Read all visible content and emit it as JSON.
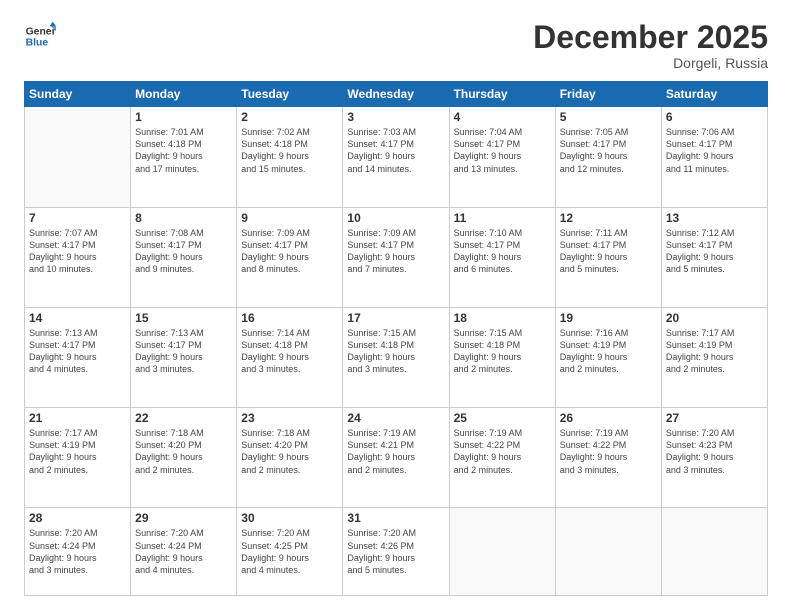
{
  "logo": {
    "line1": "General",
    "line2": "Blue"
  },
  "title": "December 2025",
  "location": "Dorgeli, Russia",
  "days_header": [
    "Sunday",
    "Monday",
    "Tuesday",
    "Wednesday",
    "Thursday",
    "Friday",
    "Saturday"
  ],
  "weeks": [
    [
      {
        "num": "",
        "info": ""
      },
      {
        "num": "1",
        "info": "Sunrise: 7:01 AM\nSunset: 4:18 PM\nDaylight: 9 hours\nand 17 minutes."
      },
      {
        "num": "2",
        "info": "Sunrise: 7:02 AM\nSunset: 4:18 PM\nDaylight: 9 hours\nand 15 minutes."
      },
      {
        "num": "3",
        "info": "Sunrise: 7:03 AM\nSunset: 4:17 PM\nDaylight: 9 hours\nand 14 minutes."
      },
      {
        "num": "4",
        "info": "Sunrise: 7:04 AM\nSunset: 4:17 PM\nDaylight: 9 hours\nand 13 minutes."
      },
      {
        "num": "5",
        "info": "Sunrise: 7:05 AM\nSunset: 4:17 PM\nDaylight: 9 hours\nand 12 minutes."
      },
      {
        "num": "6",
        "info": "Sunrise: 7:06 AM\nSunset: 4:17 PM\nDaylight: 9 hours\nand 11 minutes."
      }
    ],
    [
      {
        "num": "7",
        "info": "Sunrise: 7:07 AM\nSunset: 4:17 PM\nDaylight: 9 hours\nand 10 minutes."
      },
      {
        "num": "8",
        "info": "Sunrise: 7:08 AM\nSunset: 4:17 PM\nDaylight: 9 hours\nand 9 minutes."
      },
      {
        "num": "9",
        "info": "Sunrise: 7:09 AM\nSunset: 4:17 PM\nDaylight: 9 hours\nand 8 minutes."
      },
      {
        "num": "10",
        "info": "Sunrise: 7:09 AM\nSunset: 4:17 PM\nDaylight: 9 hours\nand 7 minutes."
      },
      {
        "num": "11",
        "info": "Sunrise: 7:10 AM\nSunset: 4:17 PM\nDaylight: 9 hours\nand 6 minutes."
      },
      {
        "num": "12",
        "info": "Sunrise: 7:11 AM\nSunset: 4:17 PM\nDaylight: 9 hours\nand 5 minutes."
      },
      {
        "num": "13",
        "info": "Sunrise: 7:12 AM\nSunset: 4:17 PM\nDaylight: 9 hours\nand 5 minutes."
      }
    ],
    [
      {
        "num": "14",
        "info": "Sunrise: 7:13 AM\nSunset: 4:17 PM\nDaylight: 9 hours\nand 4 minutes."
      },
      {
        "num": "15",
        "info": "Sunrise: 7:13 AM\nSunset: 4:17 PM\nDaylight: 9 hours\nand 3 minutes."
      },
      {
        "num": "16",
        "info": "Sunrise: 7:14 AM\nSunset: 4:18 PM\nDaylight: 9 hours\nand 3 minutes."
      },
      {
        "num": "17",
        "info": "Sunrise: 7:15 AM\nSunset: 4:18 PM\nDaylight: 9 hours\nand 3 minutes."
      },
      {
        "num": "18",
        "info": "Sunrise: 7:15 AM\nSunset: 4:18 PM\nDaylight: 9 hours\nand 2 minutes."
      },
      {
        "num": "19",
        "info": "Sunrise: 7:16 AM\nSunset: 4:19 PM\nDaylight: 9 hours\nand 2 minutes."
      },
      {
        "num": "20",
        "info": "Sunrise: 7:17 AM\nSunset: 4:19 PM\nDaylight: 9 hours\nand 2 minutes."
      }
    ],
    [
      {
        "num": "21",
        "info": "Sunrise: 7:17 AM\nSunset: 4:19 PM\nDaylight: 9 hours\nand 2 minutes."
      },
      {
        "num": "22",
        "info": "Sunrise: 7:18 AM\nSunset: 4:20 PM\nDaylight: 9 hours\nand 2 minutes."
      },
      {
        "num": "23",
        "info": "Sunrise: 7:18 AM\nSunset: 4:20 PM\nDaylight: 9 hours\nand 2 minutes."
      },
      {
        "num": "24",
        "info": "Sunrise: 7:19 AM\nSunset: 4:21 PM\nDaylight: 9 hours\nand 2 minutes."
      },
      {
        "num": "25",
        "info": "Sunrise: 7:19 AM\nSunset: 4:22 PM\nDaylight: 9 hours\nand 2 minutes."
      },
      {
        "num": "26",
        "info": "Sunrise: 7:19 AM\nSunset: 4:22 PM\nDaylight: 9 hours\nand 3 minutes."
      },
      {
        "num": "27",
        "info": "Sunrise: 7:20 AM\nSunset: 4:23 PM\nDaylight: 9 hours\nand 3 minutes."
      }
    ],
    [
      {
        "num": "28",
        "info": "Sunrise: 7:20 AM\nSunset: 4:24 PM\nDaylight: 9 hours\nand 3 minutes."
      },
      {
        "num": "29",
        "info": "Sunrise: 7:20 AM\nSunset: 4:24 PM\nDaylight: 9 hours\nand 4 minutes."
      },
      {
        "num": "30",
        "info": "Sunrise: 7:20 AM\nSunset: 4:25 PM\nDaylight: 9 hours\nand 4 minutes."
      },
      {
        "num": "31",
        "info": "Sunrise: 7:20 AM\nSunset: 4:26 PM\nDaylight: 9 hours\nand 5 minutes."
      },
      {
        "num": "",
        "info": ""
      },
      {
        "num": "",
        "info": ""
      },
      {
        "num": "",
        "info": ""
      }
    ]
  ]
}
